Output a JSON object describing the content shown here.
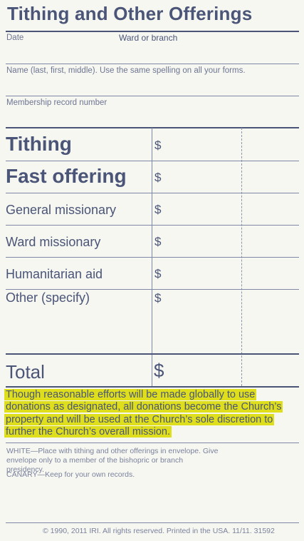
{
  "form": {
    "title": "Tithing and Other Offerings",
    "date_label": "Date",
    "ward_label": "Ward or branch",
    "name_label": "Name (last, first, middle). Use the same spelling on all your forms.",
    "membership_label": "Membership record number"
  },
  "rows": [
    {
      "label": "Tithing",
      "currency": "$"
    },
    {
      "label": "Fast offering",
      "currency": "$"
    },
    {
      "label": "General missionary",
      "currency": "$"
    },
    {
      "label": "Ward missionary",
      "currency": "$"
    },
    {
      "label": "Humanitarian aid",
      "currency": "$"
    },
    {
      "label": "Other (specify)",
      "currency": "$"
    }
  ],
  "total": {
    "label": "Total",
    "currency": "$"
  },
  "notice": "Though reasonable efforts will be made globally to use donations as designated, all donations become the Church’s property and will be used at the Church’s sole discretion to further the Church’s overall mission.",
  "instructions": {
    "white_label": "WHITE",
    "white_text": "Place with tithing and other offerings in envelope. Give envelope only to a member of the bishopric or branch presidency.",
    "canary_label": "CANARY",
    "canary_text": "Keep for your own records."
  },
  "footer": {
    "copyright_symbol": "©",
    "copyright_text": "1990, 2011 IRI. All rights reserved. Printed in the USA. 11/11. 31592"
  },
  "colors": {
    "text": "#4a5578",
    "highlight": "#dede1c",
    "background": "#f7f7f1"
  }
}
